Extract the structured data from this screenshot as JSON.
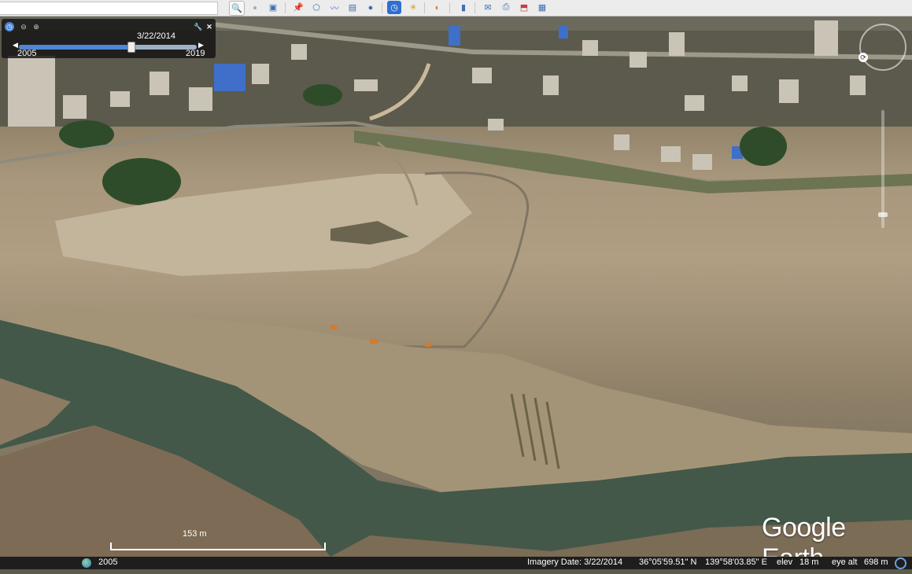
{
  "toolbar": {
    "buttons": [
      {
        "icon": "magnifier-icon",
        "glyph": "🔍"
      },
      {
        "icon": "sidebar-icon",
        "glyph": "▣"
      },
      {
        "icon": "placemark-icon",
        "glyph": "📌"
      },
      {
        "icon": "polygon-icon",
        "glyph": "⬠"
      },
      {
        "icon": "path-icon",
        "glyph": "〰"
      },
      {
        "icon": "image-overlay-icon",
        "glyph": "▤"
      },
      {
        "icon": "record-tour-icon",
        "glyph": "●"
      },
      {
        "icon": "historical-imagery-icon",
        "glyph": "◷"
      },
      {
        "icon": "sunlight-icon",
        "glyph": "☀"
      },
      {
        "icon": "planets-icon",
        "glyph": "◐"
      },
      {
        "icon": "ruler-icon",
        "glyph": "▮"
      },
      {
        "icon": "email-icon",
        "glyph": "✉"
      },
      {
        "icon": "print-icon",
        "glyph": "⎙"
      },
      {
        "icon": "save-image-icon",
        "glyph": "⬒"
      },
      {
        "icon": "view-in-maps-icon",
        "glyph": "▦"
      }
    ]
  },
  "timeline": {
    "current_date": "3/22/2014",
    "start_year": "2005",
    "end_year": "2019",
    "position_fraction": 0.63
  },
  "map": {
    "brand": "Google Earth",
    "scale_label": "153 m"
  },
  "status": {
    "tour_year": "2005",
    "imagery_date": "Imagery Date: 3/22/2014",
    "latitude": "36°05'59.51\" N",
    "longitude": "139°58'03.85\" E",
    "elev_label": "elev",
    "elev_value": "18 m",
    "eye_alt_label": "eye alt",
    "eye_alt_value": "698 m"
  }
}
